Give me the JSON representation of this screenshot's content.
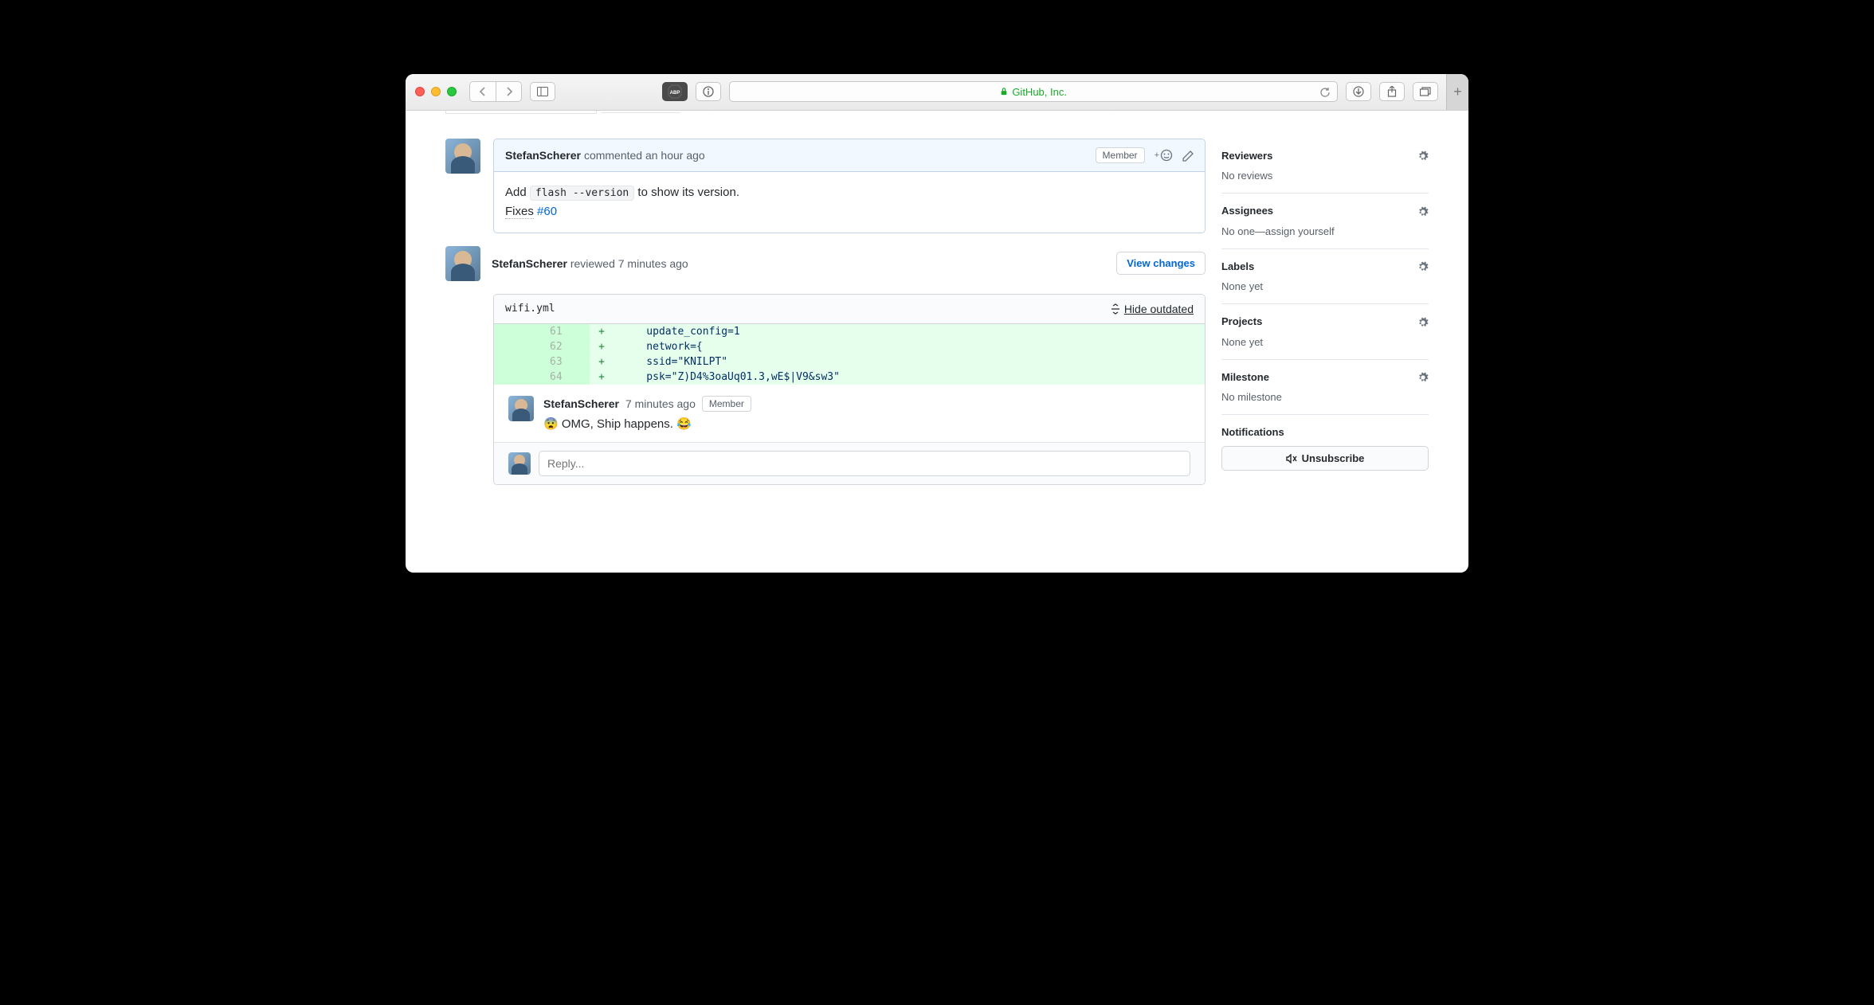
{
  "browser": {
    "site_label": "GitHub, Inc."
  },
  "comment": {
    "author": "StefanScherer",
    "action": "commented an hour ago",
    "badge": "Member",
    "body_prefix": "Add ",
    "body_code": "flash --version",
    "body_suffix": " to show its version.",
    "fixes_label": "Fixes",
    "issue_ref": "#60"
  },
  "review": {
    "author": "StefanScherer",
    "action": "reviewed 7 minutes ago",
    "view_changes": "View changes",
    "file": "wifi.yml",
    "hide_outdated": "Hide outdated",
    "diff_lines": [
      {
        "num": "61",
        "marker": "+",
        "code": "    update_config=1"
      },
      {
        "num": "62",
        "marker": "+",
        "code": "    network={"
      },
      {
        "num": "63",
        "marker": "+",
        "code": "    ssid=\"KNILPT\""
      },
      {
        "num": "64",
        "marker": "+",
        "code": "    psk=\"Z)D4%3oaUq01.3,wE$|V9&sw3\""
      }
    ],
    "review_comment": {
      "author": "StefanScherer",
      "time": "7 minutes ago",
      "badge": "Member",
      "text": "😨 OMG, Ship happens. 😂"
    },
    "reply_placeholder": "Reply..."
  },
  "sidebar": {
    "reviewers": {
      "title": "Reviewers",
      "body": "No reviews"
    },
    "assignees": {
      "title": "Assignees",
      "body_prefix": "No one—",
      "link": "assign yourself"
    },
    "labels": {
      "title": "Labels",
      "body": "None yet"
    },
    "projects": {
      "title": "Projects",
      "body": "None yet"
    },
    "milestone": {
      "title": "Milestone",
      "body": "No milestone"
    },
    "notifications": {
      "title": "Notifications",
      "button": "Unsubscribe"
    }
  }
}
